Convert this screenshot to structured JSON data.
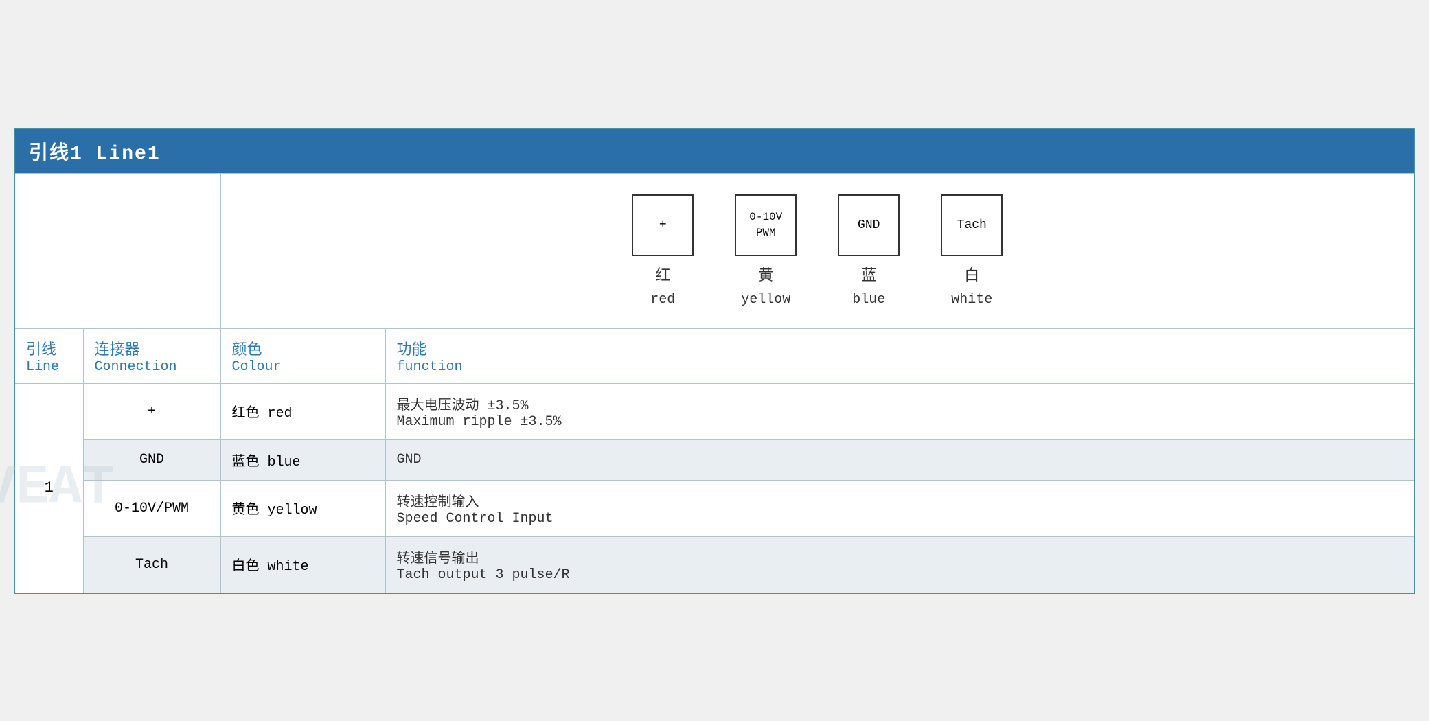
{
  "title": {
    "cn": "引线1 Line1",
    "label": "引线1 Line1"
  },
  "connectors": [
    {
      "symbol": "+",
      "label_cn": "红",
      "label_en": "red"
    },
    {
      "symbol": "0-10V\nPWM",
      "label_cn": "黄",
      "label_en": "yellow"
    },
    {
      "symbol": "GND",
      "label_cn": "蓝",
      "label_en": "blue"
    },
    {
      "symbol": "Tach",
      "label_cn": "白",
      "label_en": "white"
    }
  ],
  "column_headers": [
    {
      "cn": "引线",
      "en": "Line"
    },
    {
      "cn": "连接器",
      "en": "Connection"
    },
    {
      "cn": "颜色",
      "en": "Colour"
    },
    {
      "cn": "功能",
      "en": "function"
    }
  ],
  "rows": [
    {
      "line": "1",
      "connection": "+",
      "colour_cn": "红色",
      "colour_en": "red",
      "func_cn": "最大电压波动 ±3.5%",
      "func_en": "Maximum ripple ±3.5%",
      "shaded": false
    },
    {
      "line": "",
      "connection": "GND",
      "colour_cn": "蓝色",
      "colour_en": "blue",
      "func_cn": "GND",
      "func_en": "",
      "shaded": true
    },
    {
      "line": "",
      "connection": "0-10V/PWM",
      "colour_cn": "黄色",
      "colour_en": "yellow",
      "func_cn": "转速控制输入",
      "func_en": "Speed Control Input",
      "shaded": false
    },
    {
      "line": "",
      "connection": "Tach",
      "colour_cn": "白色",
      "colour_en": "white",
      "func_cn": "转速信号输出",
      "func_en": "Tach output 3 pulse/R",
      "shaded": true
    }
  ]
}
